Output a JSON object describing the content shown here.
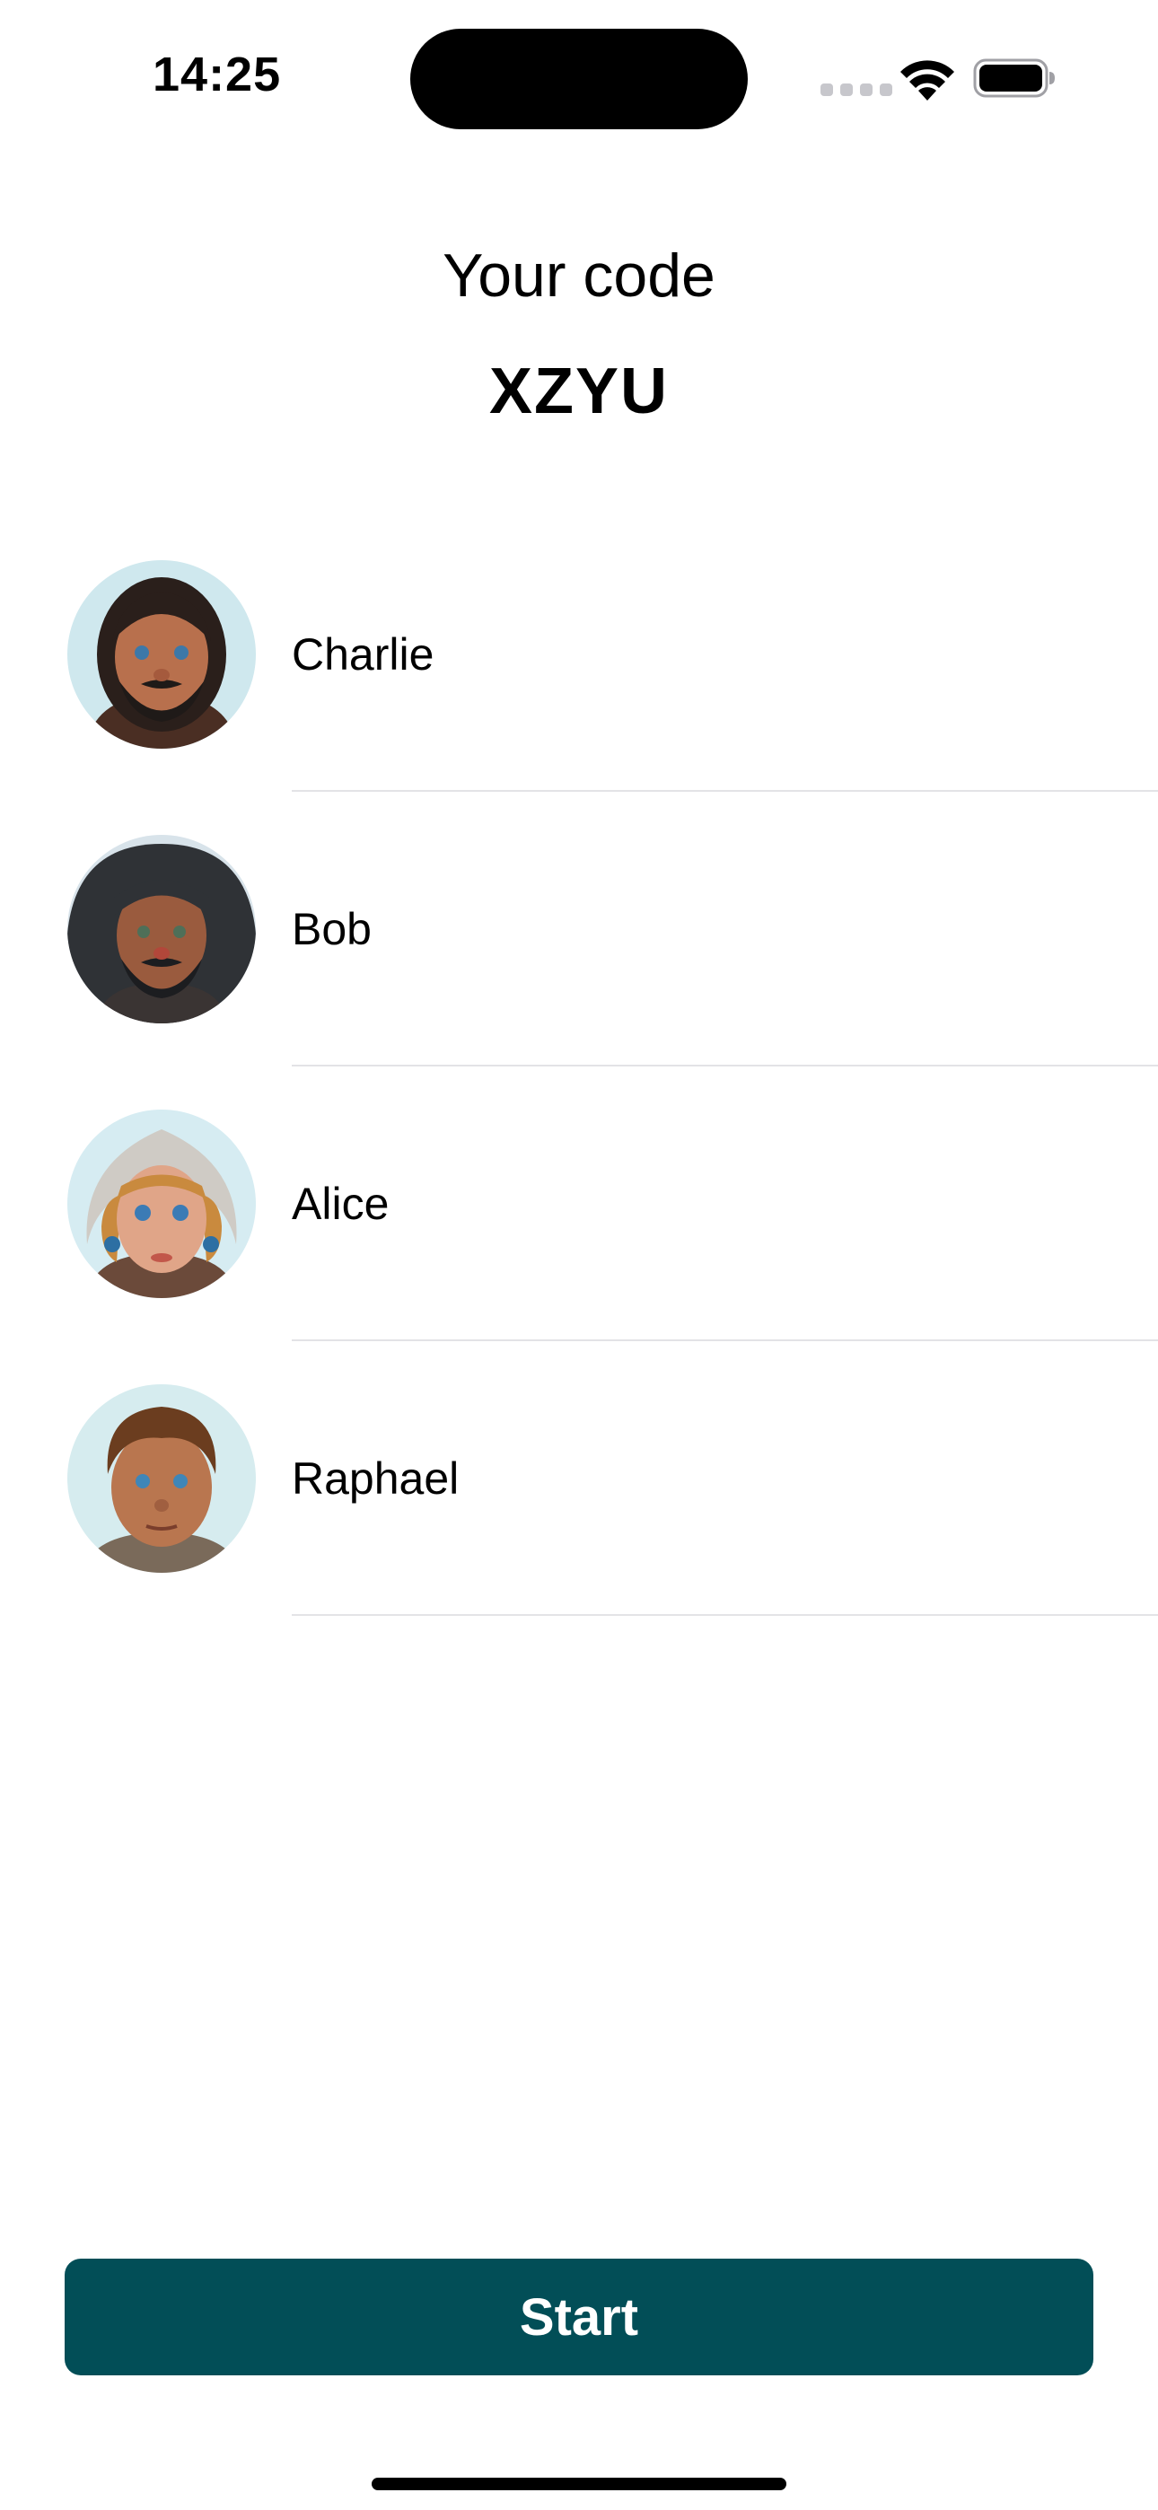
{
  "status_bar": {
    "time": "14:25",
    "icons": [
      "cellular-signal-icon",
      "wifi-icon",
      "battery-icon"
    ]
  },
  "header": {
    "label": "Your code",
    "code": "XZYU"
  },
  "players": [
    {
      "name": "Charlie",
      "avatar": "bearded-man-portrait"
    },
    {
      "name": "Bob",
      "avatar": "hooded-bearded-man-portrait"
    },
    {
      "name": "Alice",
      "avatar": "woman-headscarf-portrait"
    },
    {
      "name": "Raphael",
      "avatar": "young-man-portrait"
    }
  ],
  "actions": {
    "start_label": "Start"
  },
  "colors": {
    "accent": "#024e57",
    "separator": "#e3e3e6",
    "background": "#ffffff"
  }
}
